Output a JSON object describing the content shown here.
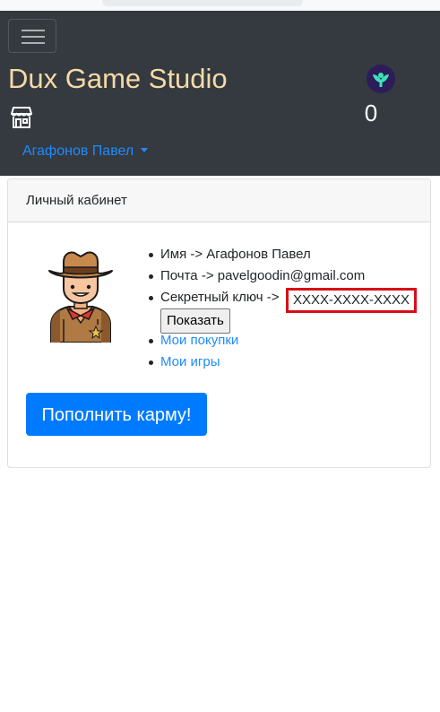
{
  "navbar": {
    "brand": "Dux Game Studio",
    "karma_count": "0",
    "user_menu": "Агафонов Павел"
  },
  "card": {
    "header": "Личный кабинет",
    "info": {
      "name_line": "Имя -> Агафонов Павел",
      "email_line": "Почта -> pavelgoodin@gmail.com",
      "secret_label": "Секретный ключ ->",
      "secret_value": "XXXX-XXXX-XXXX",
      "show_button": "Показать",
      "purchases_link": "Мои покупки",
      "games_link": "Мои игры"
    },
    "topup_button": "Пополнить карму!"
  },
  "colors": {
    "navbar_bg": "#343a40",
    "brand": "#f7d9a6",
    "link": "#1f8bff",
    "primary_button": "#007bff",
    "highlight_box": "#d80d17"
  },
  "icons": [
    "store-icon",
    "karma-icon",
    "cowboy-avatar"
  ]
}
